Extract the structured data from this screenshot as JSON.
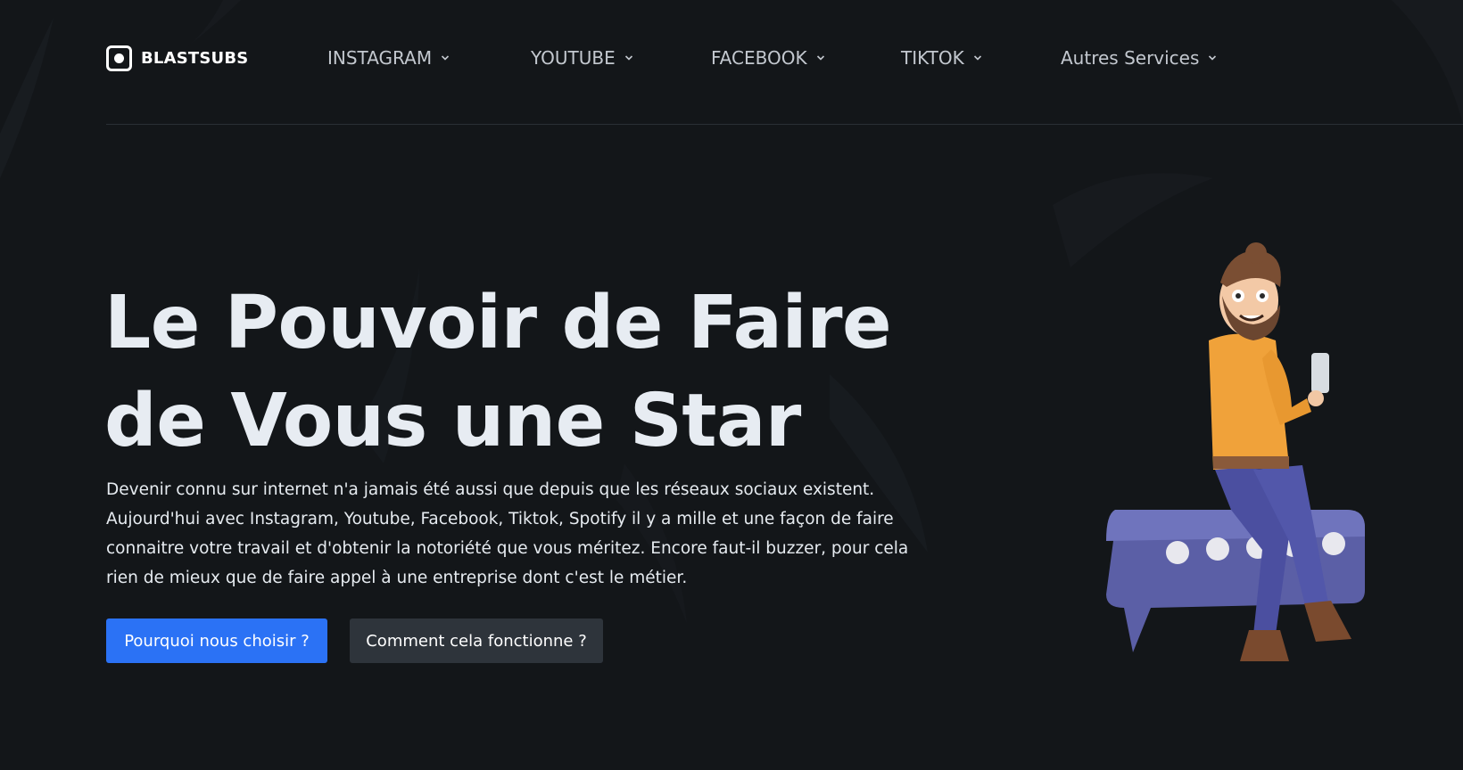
{
  "header": {
    "brand": "BLASTSUBS",
    "nav": [
      {
        "label": "INSTAGRAM"
      },
      {
        "label": "YOUTUBE"
      },
      {
        "label": "FACEBOOK"
      },
      {
        "label": "TIKTOK"
      },
      {
        "label": "Autres Services"
      }
    ]
  },
  "hero": {
    "title_line1": "Le Pouvoir de Faire",
    "title_line2": "de Vous une Star",
    "description_lines": [
      "Devenir connu sur internet n'a jamais été aussi que depuis que les réseaux sociaux existent.",
      "Aujourd'hui avec Instagram, Youtube, Facebook, Tiktok, Spotify il y a mille et une façon de faire",
      "connaitre votre travail et d'obtenir la notoriété que vous méritez. Encore faut-il buzzer, pour cela",
      "rien de mieux que de faire appel à une entreprise dont c'est le métier."
    ],
    "primary_button": "Pourquoi nous choisir ?",
    "secondary_button": "Comment cela fonctionne ?"
  },
  "colors": {
    "background": "#131619",
    "primary": "#2b72f5",
    "secondary": "#2e343b",
    "text": "#e6ebf0",
    "nav_text": "#c3c8cf"
  },
  "icons": {
    "logo": "record-square-icon",
    "dropdown": "chevron-down-icon",
    "illustration": "man-on-chat-bubble-illustration"
  }
}
